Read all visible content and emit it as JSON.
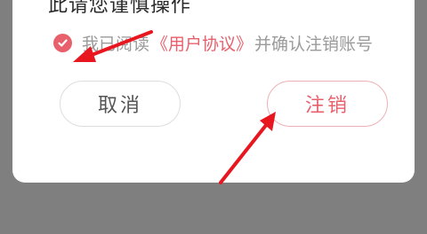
{
  "dialog": {
    "warning_line_partial": "……………………………………",
    "warning_line": "此请您谨慎操作",
    "agreement": {
      "prefix": "我已阅读",
      "link": "《用户协议》",
      "suffix": "并确认注销账号",
      "checked": true
    },
    "cancel_label": "取消",
    "confirm_label": "注销"
  },
  "colors": {
    "accent": "#e8606c",
    "overlay": "#7f7f7f",
    "annotation_arrow": "#e8161f"
  },
  "icons": {
    "checkbox": "check-circle-icon",
    "annotation": "red-arrow-icon"
  }
}
